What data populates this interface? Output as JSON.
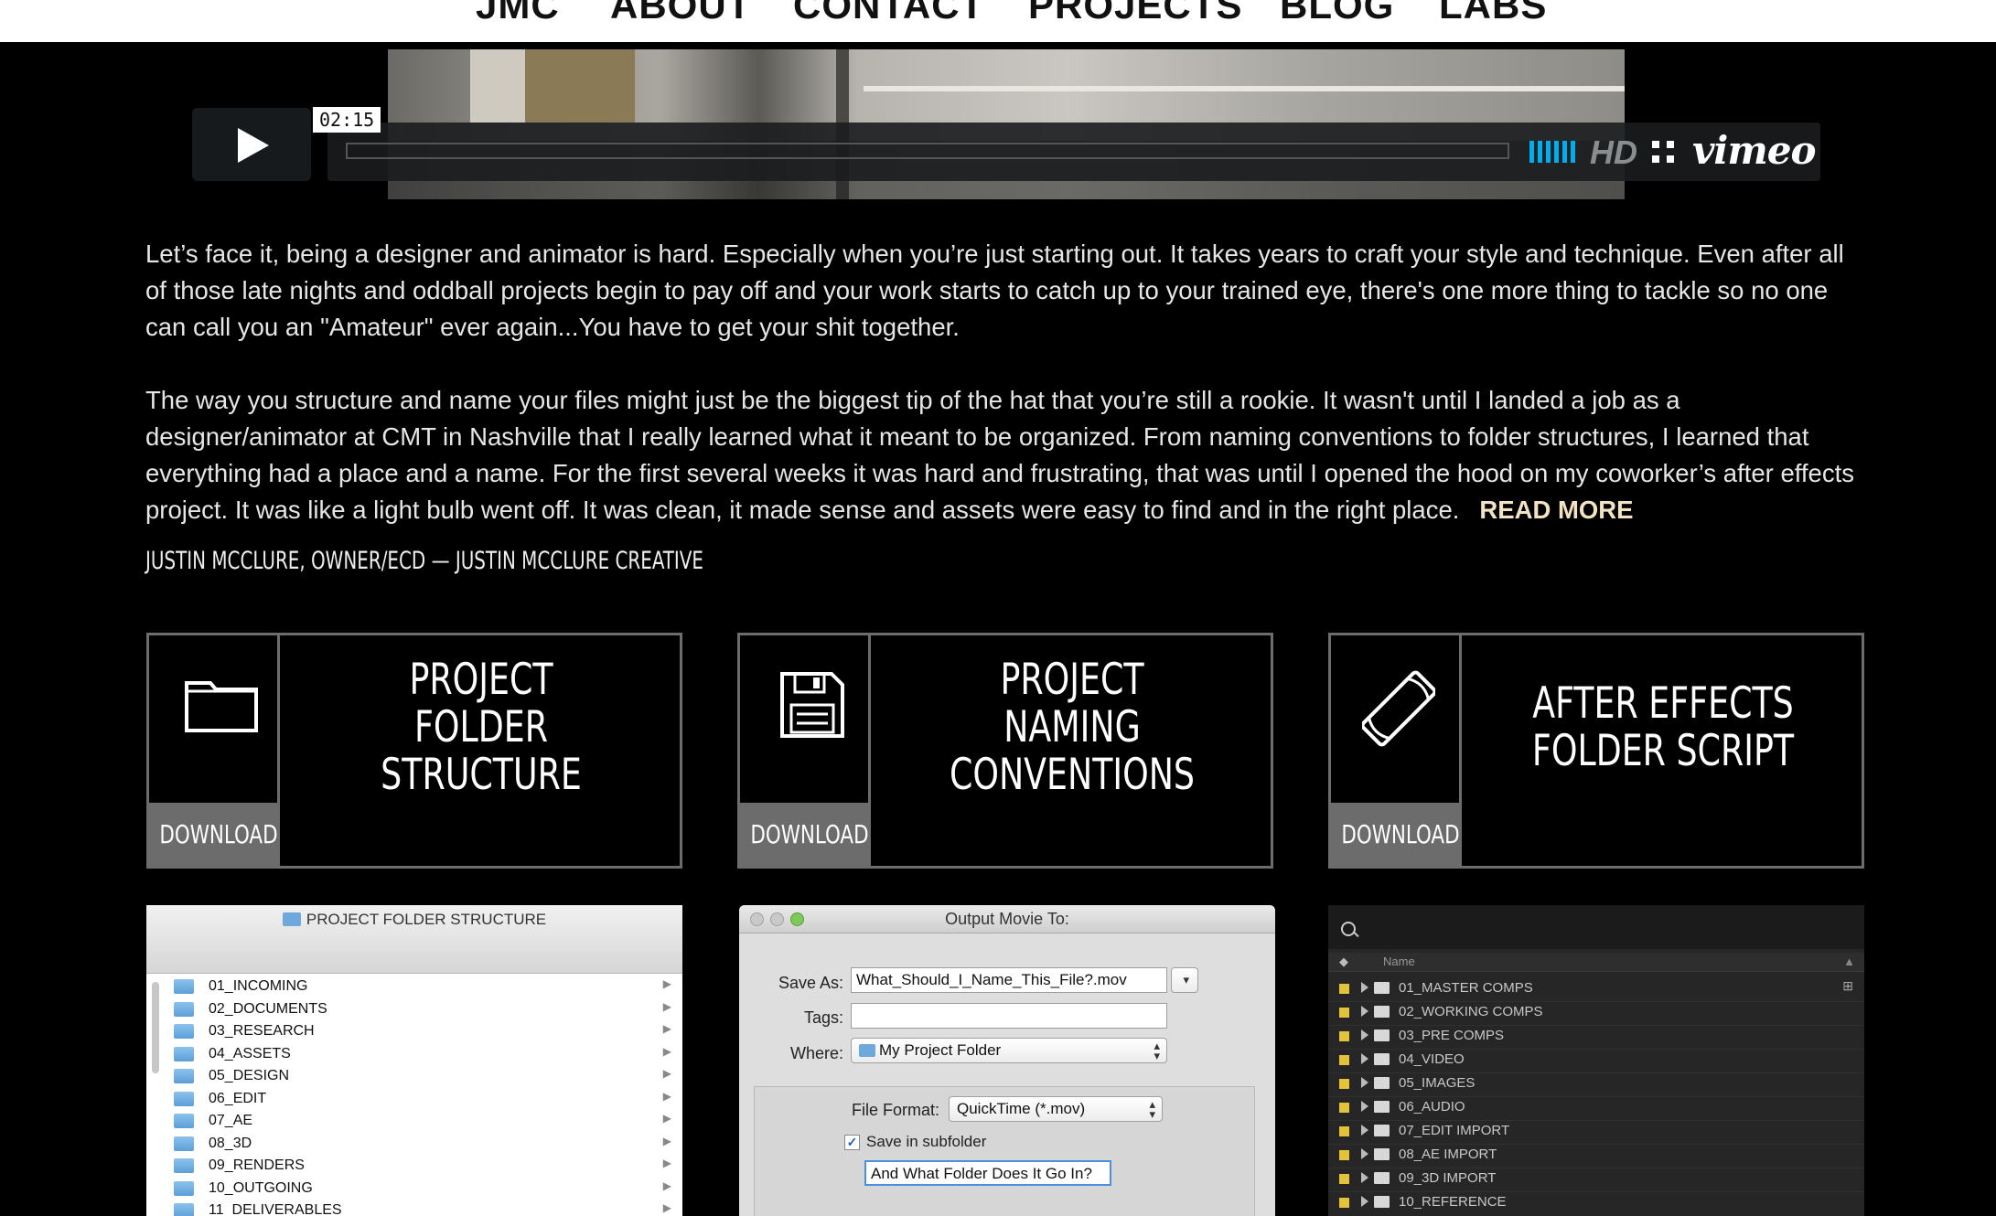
{
  "nav": {
    "items": [
      "JMC",
      "ABOUT",
      "CONTACT",
      "PROJECTS",
      "BLOG",
      "LABS"
    ]
  },
  "video": {
    "timecode": "02:15",
    "hd_label": "HD",
    "brand": "vimeo",
    "accent_color": "#00adef",
    "icons": [
      "play-icon",
      "volume-icon",
      "fullscreen-icon"
    ]
  },
  "article": {
    "paragraph1": "Let’s face it, being a designer and animator is hard. Especially when you’re just starting out. It takes years to craft your style and technique. Even after all of those late nights and oddball projects begin to pay off and your work starts to catch up to your trained eye, there's one more thing to tackle so no one can call you an \"Amateur\" ever again...You have to get your shit together.",
    "paragraph2": "The way you structure and name your files might just be the biggest tip of the hat that you’re still a rookie. It wasn't until I landed a job as a designer/animator at CMT in Nashville that I really learned what it meant to be organized. From naming conventions to folder structures, I learned that everything had a place and a name. For the first several weeks it was hard and frustrating, that was until I opened the hood on my coworker’s after effects project. It was like a light bulb went off. It was clean, it made sense and assets were easy to find and in the right place.",
    "read_more": "READ MORE",
    "read_more_color": "#f3e2c4",
    "byline": "JUSTIN MCCLURE, OWNER/ECD — JUSTIN MCCLURE CREATIVE"
  },
  "cards": [
    {
      "title": "PROJECT FOLDER STRUCTURE",
      "download": "DOWNLOAD",
      "icon": "folder-icon"
    },
    {
      "title": "PROJECT NAMING CONVENTIONS",
      "download": "DOWNLOAD",
      "icon": "floppy-disk-icon"
    },
    {
      "title": "AFTER EFFECTS FOLDER SCRIPT",
      "download": "DOWNLOAD",
      "icon": "scroll-icon"
    }
  ],
  "finder": {
    "title": "PROJECT FOLDER STRUCTURE",
    "folders": [
      "01_INCOMING",
      "02_DOCUMENTS",
      "03_RESEARCH",
      "04_ASSETS",
      "05_DESIGN",
      "06_EDIT",
      "07_AE",
      "08_3D",
      "09_RENDERS",
      "10_OUTGOING",
      "11_DELIVERABLES"
    ]
  },
  "dialog": {
    "title": "Output Movie To:",
    "save_as_label": "Save As:",
    "save_as_value": "What_Should_I_Name_This_File?.mov",
    "tags_label": "Tags:",
    "tags_value": "",
    "where_label": "Where:",
    "where_value": "My Project Folder",
    "format_label": "File Format:",
    "format_value": "QuickTime (*.mov)",
    "subfolder_label": "Save in subfolder",
    "subfolder_checked": true,
    "subfolder_value": "And What Folder Does It Go In?"
  },
  "ae_panel": {
    "column_name": "Name",
    "label_color": "#e3c33a",
    "folders": [
      "01_MASTER COMPS",
      "02_WORKING COMPS",
      "03_PRE COMPS",
      "04_VIDEO",
      "05_IMAGES",
      "06_AUDIO",
      "07_EDIT IMPORT",
      "08_AE IMPORT",
      "09_3D IMPORT",
      "10_REFERENCE"
    ]
  }
}
